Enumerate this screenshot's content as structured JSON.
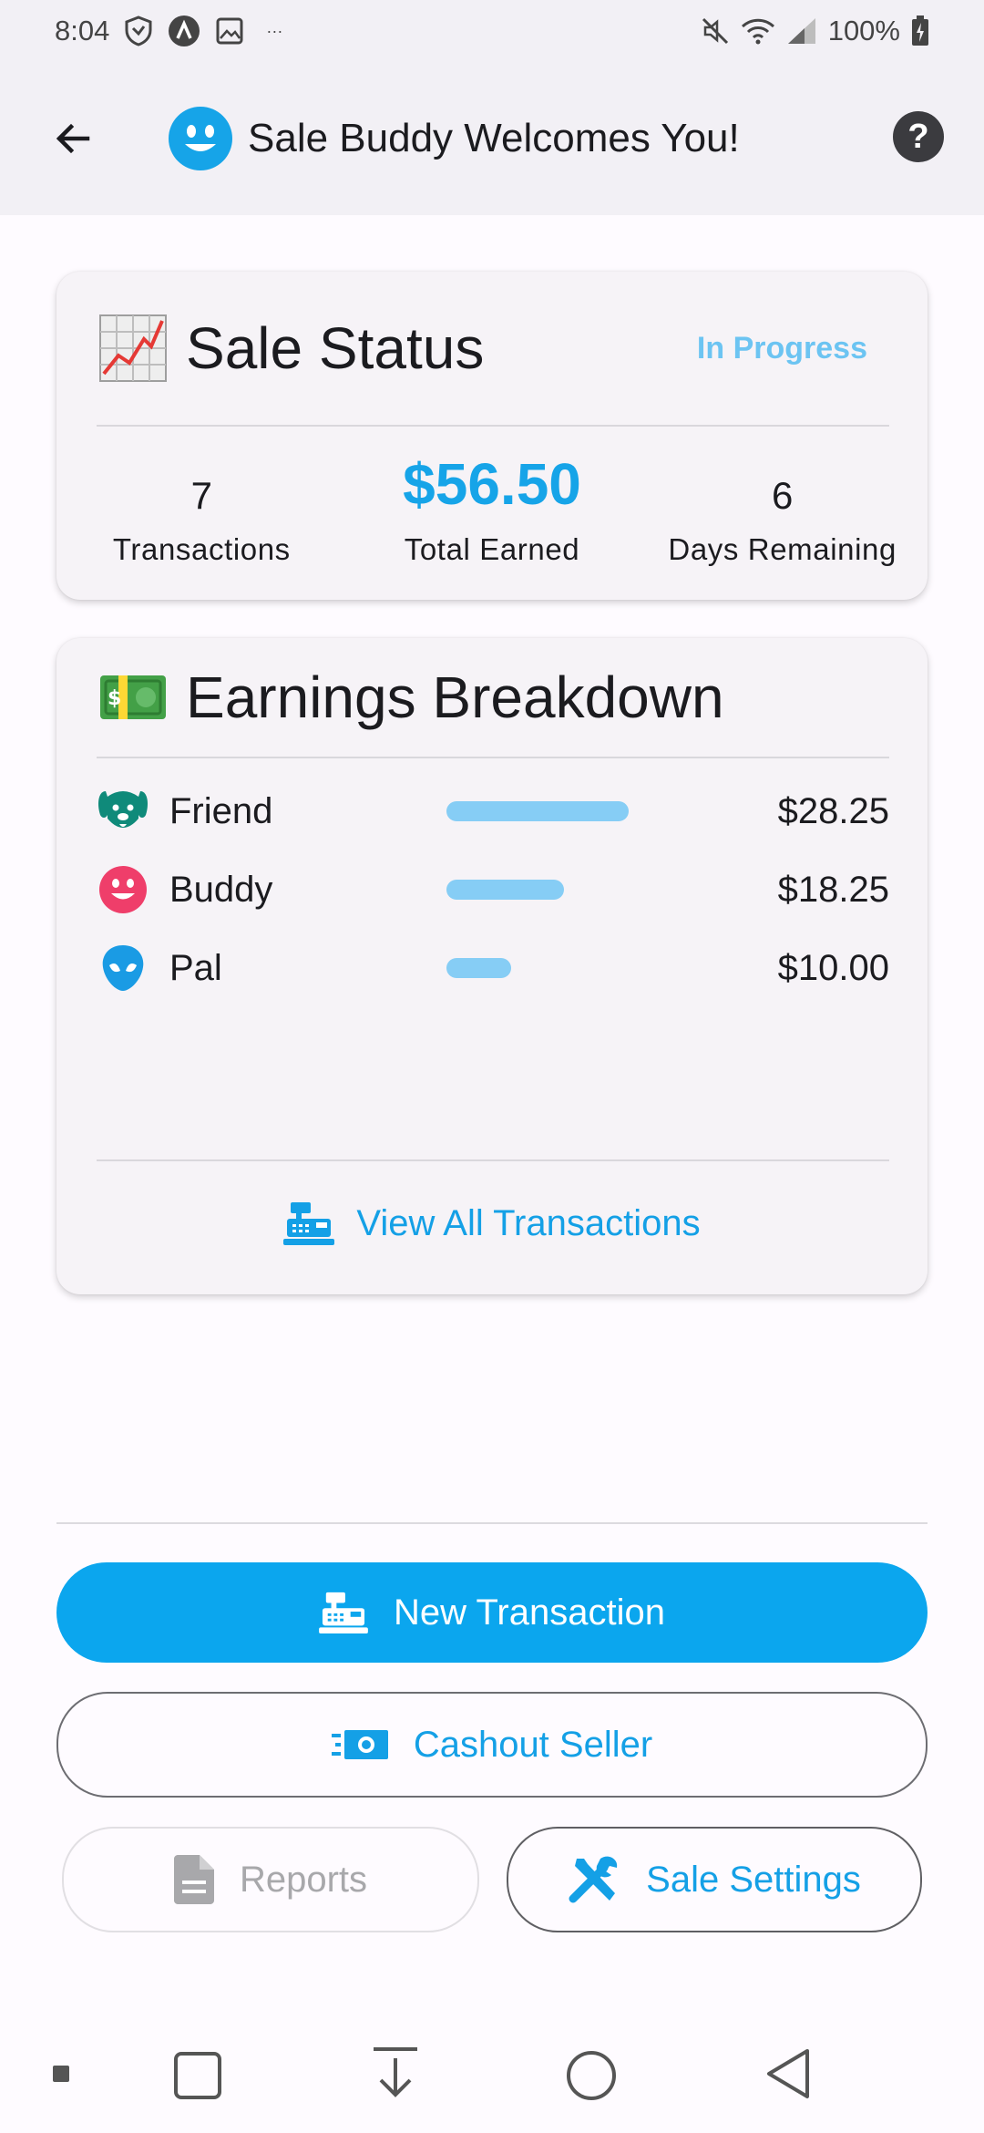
{
  "status_bar": {
    "time": "8:04",
    "more": "···",
    "battery": "100%"
  },
  "app_bar": {
    "title": "Sale Buddy Welcomes You!",
    "help": "?"
  },
  "sale_status": {
    "emoji": "📈",
    "title": "Sale Status",
    "badge": "In Progress",
    "stats": [
      {
        "value": "7",
        "label": "Transactions"
      },
      {
        "value": "$56.50",
        "label": "Total Earned"
      },
      {
        "value": "6",
        "label": "Days Remaining"
      }
    ]
  },
  "earnings": {
    "emoji": "💵",
    "title": "Earnings Breakdown",
    "rows": [
      {
        "name": "Friend",
        "amount": "$28.25",
        "fraction": 1.0,
        "icon": "dog-face-icon",
        "color": "#0f8a7a"
      },
      {
        "name": "Buddy",
        "amount": "$18.25",
        "fraction": 0.646,
        "icon": "smiley-face-icon",
        "color": "#ef3e6a"
      },
      {
        "name": "Pal",
        "amount": "$10.00",
        "fraction": 0.354,
        "icon": "alien-face-icon",
        "color": "#1a9be4"
      }
    ],
    "view_all": "View All Transactions"
  },
  "actions": {
    "new_transaction": "New Transaction",
    "cashout": "Cashout Seller",
    "reports": "Reports",
    "settings": "Sale Settings"
  },
  "colors": {
    "accent": "#0ba6ee",
    "accent_text": "#14a0e6",
    "badge": "#6cc4f2",
    "bar": "#86cdf5"
  }
}
